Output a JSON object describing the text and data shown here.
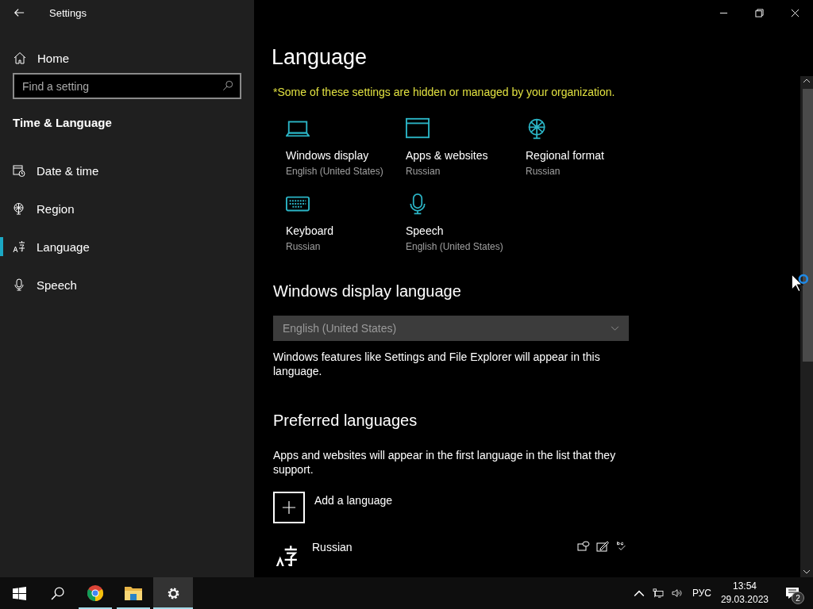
{
  "window": {
    "title": "Settings"
  },
  "sidebar": {
    "home": "Home",
    "search": {
      "placeholder": "Find a setting"
    },
    "section": "Time & Language",
    "items": [
      {
        "label": "Date & time",
        "kind": "clock",
        "selected": false
      },
      {
        "label": "Region",
        "kind": "globe",
        "selected": false
      },
      {
        "label": "Language",
        "kind": "language",
        "selected": true
      },
      {
        "label": "Speech",
        "kind": "mic",
        "selected": false
      }
    ]
  },
  "main": {
    "title": "Language",
    "notice": "*Some of these settings are hidden or managed by your organization.",
    "tiles": [
      {
        "kind": "laptop",
        "label": "Windows display",
        "value": "English (United States)"
      },
      {
        "kind": "window",
        "label": "Apps & websites",
        "value": "Russian"
      },
      {
        "kind": "globe",
        "label": "Regional format",
        "value": "Russian"
      },
      {
        "kind": "keyboard",
        "label": "Keyboard",
        "value": "Russian"
      },
      {
        "kind": "mic",
        "label": "Speech",
        "value": "English (United States)"
      }
    ],
    "display_language": {
      "heading": "Windows display language",
      "dropdown": {
        "value": "English (United States)",
        "disabled": true
      },
      "description": "Windows features like Settings and File Explorer will appear in this language."
    },
    "preferred": {
      "heading": "Preferred languages",
      "description": "Apps and websites will appear in the first language in the list that they support.",
      "add_label": "Add a language",
      "languages": [
        {
          "name": "Russian"
        }
      ]
    }
  },
  "taskbar": {
    "apps": [
      {
        "kind": "start",
        "running": false,
        "selected": false
      },
      {
        "kind": "search",
        "running": false,
        "selected": false
      },
      {
        "kind": "chrome",
        "running": true,
        "selected": false
      },
      {
        "kind": "folder",
        "running": true,
        "selected": false
      },
      {
        "kind": "settings",
        "running": true,
        "selected": true
      }
    ],
    "tray": {
      "input_language": "РУС",
      "time": "13:54",
      "date": "29.03.2023",
      "notifications": "2"
    }
  }
}
